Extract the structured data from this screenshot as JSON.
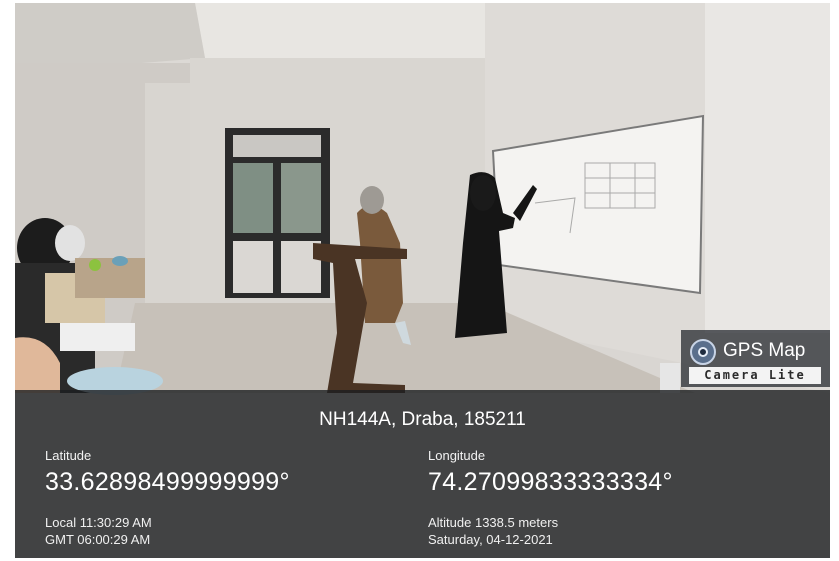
{
  "watermark": {
    "app_title": "GPS Map",
    "app_subtitle": "Camera Lite",
    "icon": "camera-lens-icon"
  },
  "location": {
    "address": "NH144A, Draba, 185211",
    "latitude_label": "Latitude",
    "latitude_value": "33.62898499999999°",
    "longitude_label": "Longitude",
    "longitude_value": "74.27099833333334°",
    "local_time": "Local 11:30:29 AM",
    "gmt_time": "GMT 06:00:29 AM",
    "altitude": "Altitude 1338.5 meters",
    "date": "Saturday, 04-12-2021"
  },
  "colors": {
    "panel": "#1c1e20",
    "text": "#ffffff"
  }
}
